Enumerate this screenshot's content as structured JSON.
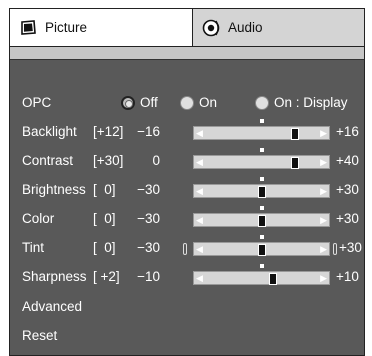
{
  "tabs": [
    {
      "label": "Picture",
      "icon": "tv-icon",
      "active": true
    },
    {
      "label": "Audio",
      "icon": "speaker-icon",
      "active": false
    }
  ],
  "opc": {
    "label": "OPC",
    "options": [
      "Off",
      "On",
      "On : Display"
    ],
    "selected": "Off"
  },
  "sliders": [
    {
      "label": "Backlight",
      "preset": "[+12]",
      "value": "−16",
      "max": "+16",
      "level": 0.8
    },
    {
      "label": "Contrast",
      "preset": "[+30]",
      "value": "0",
      "max": "+40",
      "level": 0.8
    },
    {
      "label": "Brightness",
      "preset": "[  0]",
      "value": "−30",
      "max": "+30",
      "level": 0.5
    },
    {
      "label": "Color",
      "preset": "[  0]",
      "value": "−30",
      "max": "+30",
      "level": 0.5
    },
    {
      "label": "Tint",
      "preset": "[  0]",
      "value": "−30",
      "max": "+30",
      "level": 0.5
    },
    {
      "label": "Sharpness",
      "preset": "[ +2]",
      "value": "−10",
      "max": "+10",
      "level": 0.6
    }
  ],
  "menu_items": [
    "Advanced",
    "Reset"
  ],
  "colors": {
    "panel": "#595959",
    "strip": "#c6c6c6",
    "active_tab": "#ffffff",
    "inactive_tab": "#d4d4d4"
  }
}
